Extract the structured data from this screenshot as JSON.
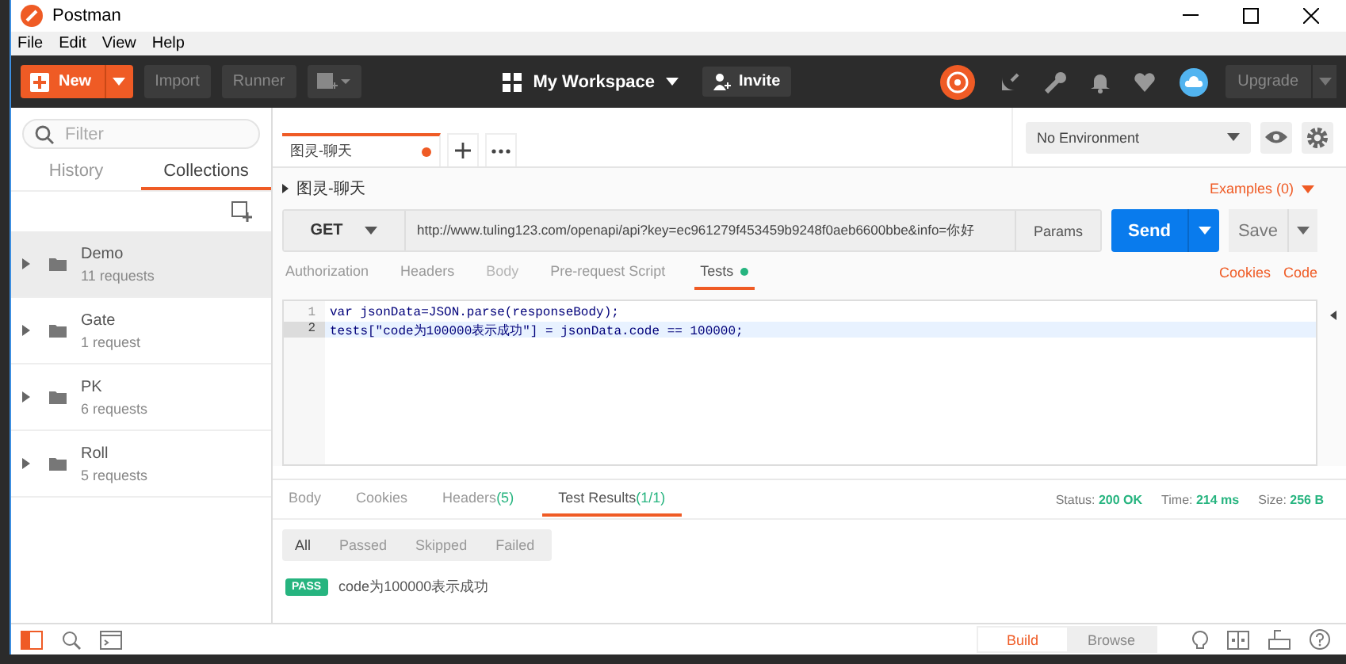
{
  "window": {
    "title": "Postman"
  },
  "menu": [
    "File",
    "Edit",
    "View",
    "Help"
  ],
  "toolbar": {
    "new": "New",
    "import": "Import",
    "runner": "Runner",
    "workspace": "My Workspace",
    "invite": "Invite",
    "upgrade": "Upgrade"
  },
  "sidebar": {
    "filter_placeholder": "Filter",
    "tabs": [
      {
        "label": "History",
        "selected": false
      },
      {
        "label": "Collections",
        "selected": true
      }
    ],
    "collections": [
      {
        "name": "Demo",
        "count": "11 requests",
        "selected": true
      },
      {
        "name": "Gate",
        "count": "1 request",
        "selected": false
      },
      {
        "name": "PK",
        "count": "6 requests",
        "selected": false
      },
      {
        "name": "Roll",
        "count": "5 requests",
        "selected": false
      }
    ]
  },
  "request_tab": {
    "title": "图灵-聊天",
    "unsaved": true
  },
  "environment": "No Environment",
  "request": {
    "name": "图灵-聊天",
    "examples": "Examples (0)",
    "method": "GET",
    "url": "http://www.tuling123.com/openapi/api?key=ec961279f453459b9248f0aeb6600bbe&info=你好",
    "params": "Params",
    "send": "Send",
    "save": "Save"
  },
  "request_tabs": [
    {
      "label": "Authorization",
      "selected": false,
      "disabled": false,
      "dot": false
    },
    {
      "label": "Headers",
      "selected": false,
      "disabled": false,
      "dot": false
    },
    {
      "label": "Body",
      "selected": false,
      "disabled": true,
      "dot": false
    },
    {
      "label": "Pre-request Script",
      "selected": false,
      "disabled": false,
      "dot": false
    },
    {
      "label": "Tests",
      "selected": true,
      "disabled": false,
      "dot": true
    }
  ],
  "request_links": [
    "Cookies",
    "Code"
  ],
  "code": [
    {
      "number": "1",
      "text": "var jsonData=JSON.parse(responseBody);",
      "selected": false
    },
    {
      "number": "2",
      "text": "tests[\"code为100000表示成功\"] = jsonData.code == 100000;",
      "selected": true
    }
  ],
  "response_tabs": [
    {
      "label": "Body",
      "selected": false
    },
    {
      "label": "Cookies",
      "selected": false
    },
    {
      "label": "Headers",
      "count": "(5)",
      "selected": false
    },
    {
      "label": "Test Results",
      "count": "(1/1)",
      "selected": true
    }
  ],
  "response_meta": [
    {
      "label": "Status:",
      "value": "200 OK"
    },
    {
      "label": "Time:",
      "value": "214 ms"
    },
    {
      "label": "Size:",
      "value": "256 B"
    }
  ],
  "result_filters": [
    {
      "label": "All",
      "selected": true
    },
    {
      "label": "Passed",
      "selected": false
    },
    {
      "label": "Skipped",
      "selected": false
    },
    {
      "label": "Failed",
      "selected": false
    }
  ],
  "results": [
    {
      "status": "PASS",
      "name": "code为100000表示成功"
    }
  ],
  "footer": [
    {
      "label": "Build",
      "selected": true
    },
    {
      "label": "Browse",
      "selected": false
    }
  ]
}
